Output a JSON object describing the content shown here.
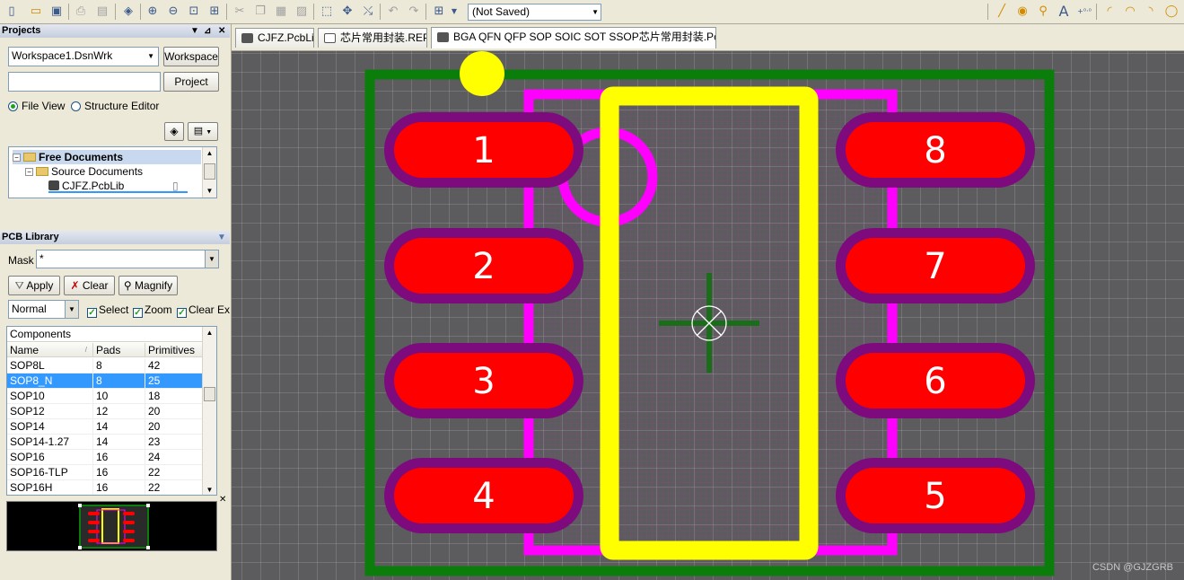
{
  "toolbar": {
    "document_state": "(Not Saved)",
    "icons": [
      "new-icon",
      "open-icon",
      "save-icon",
      "print-icon",
      "print-preview-icon",
      "layers-icon",
      "zoom-in-icon",
      "zoom-out-icon",
      "zoom-fit-icon",
      "zoom-area-icon",
      "cut-icon",
      "copy-icon",
      "paste-icon",
      "rubber-stamp-icon",
      "select-rect-icon",
      "move-icon",
      "cross-probe-icon",
      "undo-icon",
      "redo-icon",
      "grid-icon",
      "line-icon",
      "pad-icon",
      "via-icon",
      "string-icon",
      "coordinate-icon",
      "arc-center-icon",
      "arc-edge-icon",
      "arc-any-icon",
      "full-circle-icon"
    ]
  },
  "projects": {
    "title": "Projects",
    "workspace_value": "Workspace1.DsnWrk",
    "workspace_button": "Workspace",
    "project_value": "",
    "project_button": "Project",
    "view_file": "File View",
    "view_structure": "Structure Editor",
    "tree": {
      "root": "Free Documents",
      "folder": "Source Documents",
      "file": "CJFZ.PcbLib"
    }
  },
  "pcblib": {
    "title": "PCB Library",
    "mask_label": "Mask",
    "mask_value": "*",
    "apply": "Apply",
    "clear": "Clear",
    "magnify": "Magnify",
    "mode": "Normal",
    "chk_select": "Select",
    "chk_zoom": "Zoom",
    "chk_clear": "Clear Existing",
    "components_title": "Components",
    "columns": [
      "Name",
      "Pads",
      "Primitives"
    ],
    "rows": [
      {
        "name": "SOP8L",
        "pads": "8",
        "prims": "42"
      },
      {
        "name": "SOP8_N",
        "pads": "8",
        "prims": "25"
      },
      {
        "name": "SOP10",
        "pads": "10",
        "prims": "18"
      },
      {
        "name": "SOP12",
        "pads": "12",
        "prims": "20"
      },
      {
        "name": "SOP14",
        "pads": "14",
        "prims": "20"
      },
      {
        "name": "SOP14-1.27",
        "pads": "14",
        "prims": "23"
      },
      {
        "name": "SOP16",
        "pads": "16",
        "prims": "24"
      },
      {
        "name": "SOP16-TLP",
        "pads": "16",
        "prims": "22"
      },
      {
        "name": "SOP16H",
        "pads": "16",
        "prims": "22"
      }
    ],
    "selected_index": 1
  },
  "tabs": [
    {
      "label": "CJFZ.PcbLib"
    },
    {
      "label": "芯片常用封装.REP"
    },
    {
      "label": "BGA QFN QFP SOP SOIC SOT SSOP芯片常用封装.PcbLib *"
    }
  ],
  "pcb": {
    "pads_left": [
      "1",
      "2",
      "3",
      "4"
    ],
    "pads_right": [
      "8",
      "7",
      "6",
      "5"
    ],
    "colors": {
      "board_outline": "#0a7d0a",
      "silkscreen": "#ffff00",
      "courtyard": "#ff00ff",
      "pad": "#ff0000",
      "solder_mask": "#7d0b7d",
      "origin_marker": "#1a6e1a"
    }
  },
  "watermark": "CSDN @GJZGRB"
}
